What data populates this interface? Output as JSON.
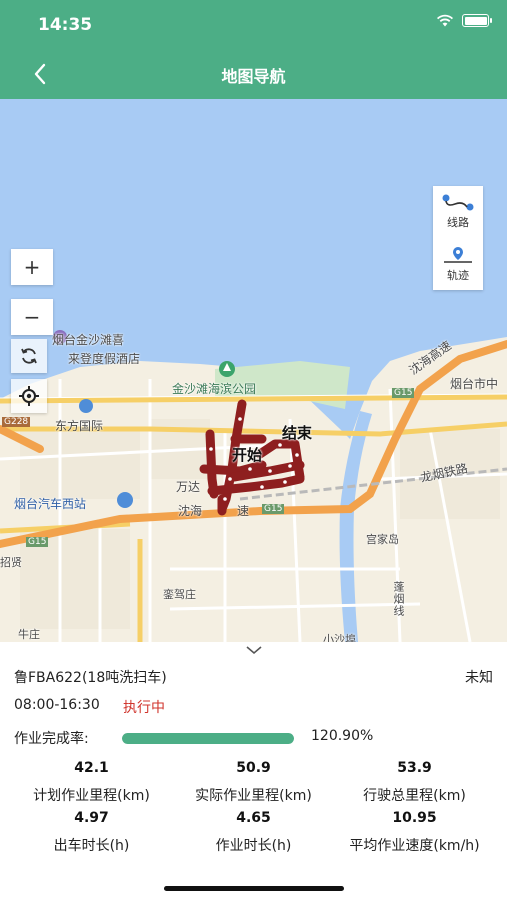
{
  "status_bar": {
    "time": "14:35"
  },
  "nav": {
    "title": "地图导航"
  },
  "map": {
    "zoom_in": "+",
    "zoom_out": "−",
    "side_buttons": [
      "线路",
      "轨迹"
    ],
    "labels": {
      "hotel_line1": "烟台金沙滩喜",
      "hotel_line2": "来登度假酒店",
      "park": "金沙滩海滨公园",
      "dongfang": "东方国际",
      "wanda": "万达",
      "bus_station": "烟台汽车西站",
      "shenhai": "沈海",
      "highway_su": "速",
      "start": "开始",
      "end": "结束",
      "g15_a": "G15",
      "g15_b": "G15",
      "g15_c": "G15",
      "g228": "G228",
      "yantai_city": "烟台市中",
      "shenhai_highway": "沈海高速",
      "longyan_railway": "龙烟铁路",
      "gongjiadao": "宫家岛",
      "luanjiazhuang": "銮驾庄",
      "xiaoshadu": "小沙埠",
      "niuzhuang": "牛庄",
      "zhaoxian": "招贤",
      "penghuang": "蓬烟线"
    }
  },
  "vehicle": {
    "plate": "鲁FBA622(18吨洗扫车)",
    "unknown_label": "未知",
    "time_range": "08:00-16:30",
    "status": "执行中",
    "status_color": "#d0342c",
    "completion_label": "作业完成率:",
    "completion_value": "120.90%",
    "completion_fraction": 1.0,
    "accent_color": "#4cae86"
  },
  "stats": [
    {
      "value": "42.1",
      "label": "计划作业里程(km)"
    },
    {
      "value": "50.9",
      "label": "实际作业里程(km)"
    },
    {
      "value": "53.9",
      "label": "行驶总里程(km)"
    },
    {
      "value": "4.97",
      "label": "出车时长(h)"
    },
    {
      "value": "4.65",
      "label": "作业时长(h)"
    },
    {
      "value": "10.95",
      "label": "平均作业速度(km/h)"
    }
  ]
}
